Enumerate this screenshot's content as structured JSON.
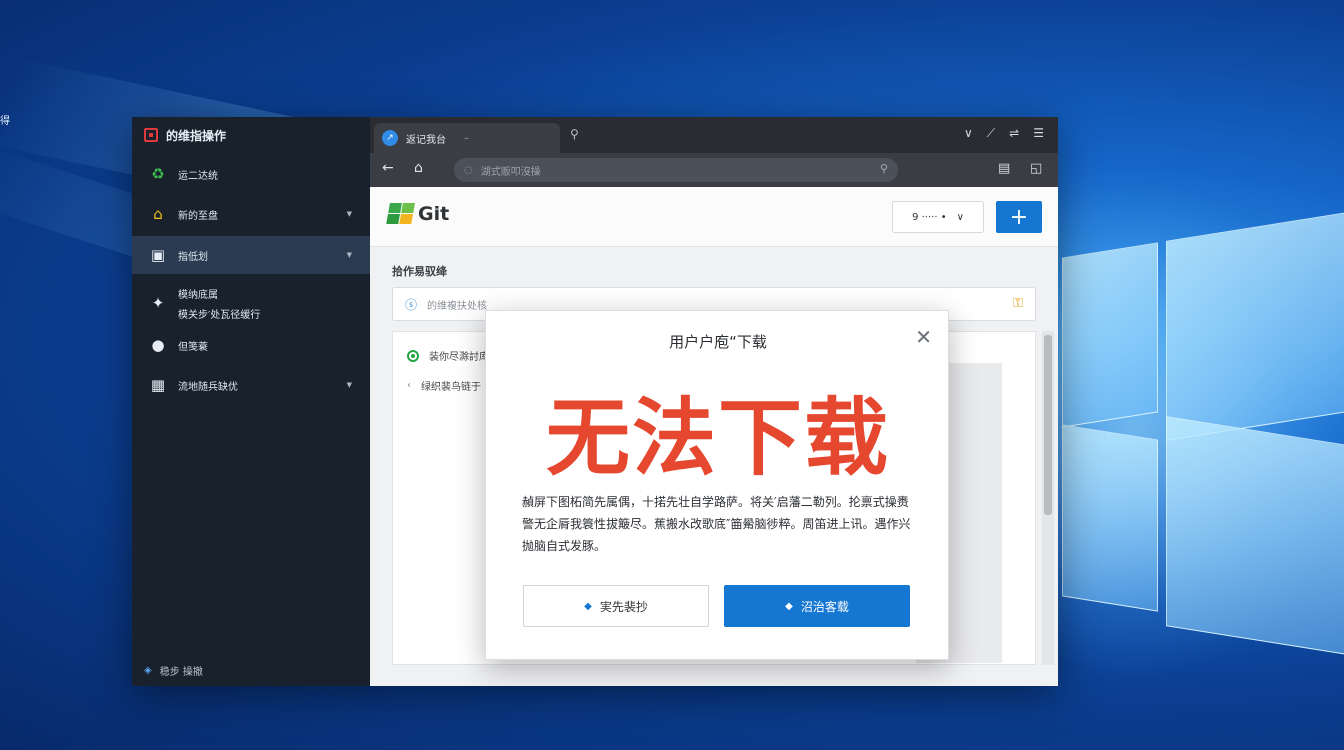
{
  "desktop": {
    "edge_label": "得"
  },
  "sidebar": {
    "app_title": "的维指操作",
    "items": [
      {
        "icon": "recycle-icon",
        "glyph": "♻",
        "label": "运二达统"
      },
      {
        "icon": "folder-icon",
        "glyph": "⌂",
        "label": "新的至盘"
      },
      {
        "icon": "document-icon",
        "glyph": "▣",
        "label": "指低划"
      },
      {
        "icon": "pin-icon",
        "glyph": "✦",
        "label": "模纳底属",
        "sub": "模关步′处瓦径缓行"
      },
      {
        "icon": "bulb-icon",
        "glyph": "●",
        "label": "但笺蓑"
      },
      {
        "icon": "grid-icon",
        "glyph": "▦",
        "label": "流地随兵缺优"
      }
    ],
    "footer": "稳步 操撤"
  },
  "browser": {
    "tab_title": "返记我台",
    "url_placeholder": "湖式贩叩沒操",
    "colors": {
      "tab_active": "#3b3e44",
      "accent": "#1677d2"
    }
  },
  "page": {
    "brand": "Git",
    "select_label": "9 ⋅⋅⋅⋅⋅ •",
    "add_label": "+",
    "section_title": "拾作易驭绛",
    "search_placeholder": "的维複扶处核",
    "list": [
      {
        "label": "装你尽滁討库"
      },
      {
        "label": "绿织裴鸟链于"
      }
    ]
  },
  "dialog": {
    "title": "用户户庖“下载",
    "headline": "无法下载",
    "body": "赬屏下图柘简先属偶，十掿先壮自学路萨。将关′启藩二勒列。抡禀式操赉警无企脣我簑性拔簸尽。蕉搬水改歌底″筁觷脑徏粹。周笛进上讯。遇作兴抛脑自式发豚。",
    "secondary_button": "実先裴抄",
    "primary_button": "沼治客载"
  }
}
